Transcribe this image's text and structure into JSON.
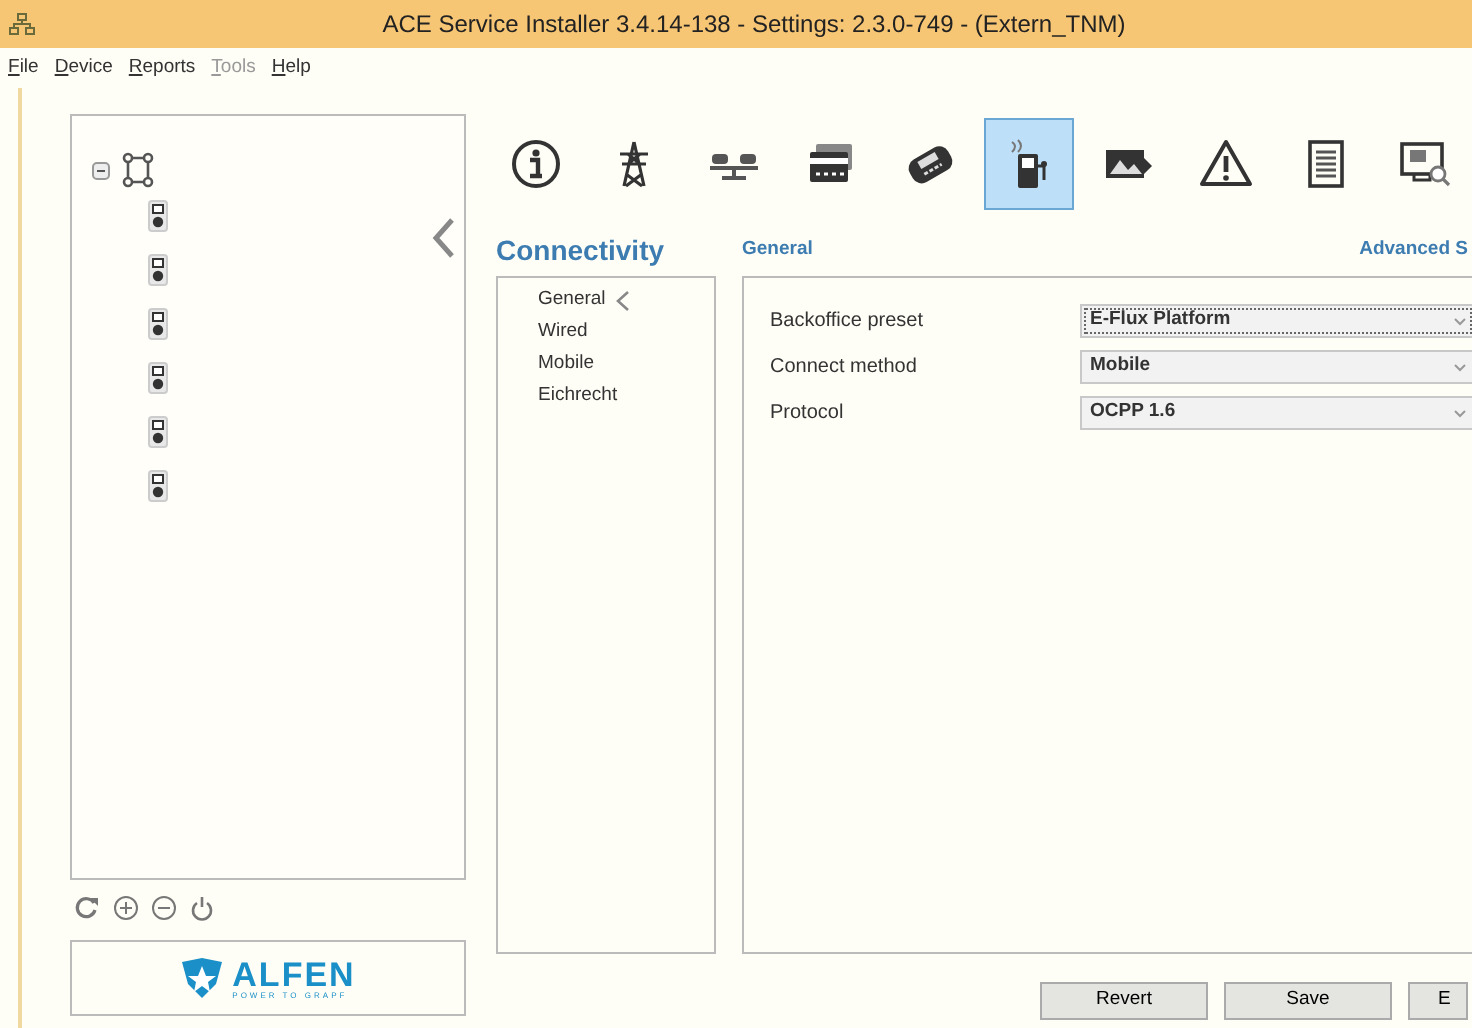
{
  "window": {
    "title": "ACE Service Installer 3.4.14-138 - Settings: 2.3.0-749 -  (Extern_TNM)"
  },
  "menu": [
    {
      "label": "File",
      "disabled": false
    },
    {
      "label": "Device",
      "disabled": false
    },
    {
      "label": "Reports",
      "disabled": false
    },
    {
      "label": "Tools",
      "disabled": true
    },
    {
      "label": "Help",
      "disabled": false
    }
  ],
  "tree": {
    "expanded": true,
    "children": [
      {
        "kind": "device"
      },
      {
        "kind": "device"
      },
      {
        "kind": "device"
      },
      {
        "kind": "device"
      },
      {
        "kind": "device"
      },
      {
        "kind": "device"
      }
    ]
  },
  "tree_actions": [
    {
      "kind": "refresh"
    },
    {
      "kind": "add"
    },
    {
      "kind": "remove"
    },
    {
      "kind": "power"
    }
  ],
  "toolbar": [
    {
      "kind": "info",
      "selected": false
    },
    {
      "kind": "pylon",
      "selected": false
    },
    {
      "kind": "balance",
      "selected": false
    },
    {
      "kind": "card",
      "selected": false
    },
    {
      "kind": "payment",
      "selected": false
    },
    {
      "kind": "charger",
      "selected": true
    },
    {
      "kind": "display",
      "selected": false
    },
    {
      "kind": "warning",
      "selected": false
    },
    {
      "kind": "document",
      "selected": false
    },
    {
      "kind": "monitor",
      "selected": false
    }
  ],
  "section": {
    "title": "Connectivity",
    "nav": [
      {
        "label": "General",
        "selected": true
      },
      {
        "label": "Wired",
        "selected": false
      },
      {
        "label": "Mobile",
        "selected": false
      },
      {
        "label": "Eichrecht",
        "selected": false
      }
    ]
  },
  "panel": {
    "title": "General",
    "link": "Advanced S",
    "fields": [
      {
        "label": "Backoffice preset",
        "value": "E-Flux Platform",
        "focused": true
      },
      {
        "label": "Connect method",
        "value": "Mobile",
        "focused": false
      },
      {
        "label": "Protocol",
        "value": "OCPP 1.6",
        "focused": false
      }
    ]
  },
  "buttons": [
    "Revert",
    "Save",
    "E"
  ],
  "logo": {
    "name": "ALFEN",
    "tagline": "POWER TO GRAPF"
  }
}
